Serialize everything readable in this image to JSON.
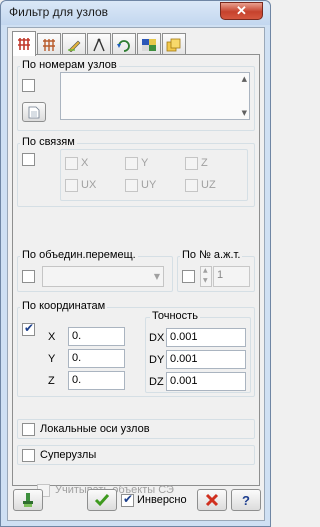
{
  "window": {
    "title": "Фильтр для узлов",
    "close_glyph": "✕"
  },
  "tabs": [
    {
      "icon": "node-filter-icon"
    },
    {
      "icon": "element-filter-icon"
    },
    {
      "icon": "pencil-filter-icon"
    },
    {
      "icon": "compass-filter-icon"
    },
    {
      "icon": "rotate-filter-icon"
    },
    {
      "icon": "color-grid-icon"
    },
    {
      "icon": "layers-copy-icon"
    }
  ],
  "by_numbers": {
    "label": "По номерам узлов"
  },
  "by_links": {
    "label": "По связям",
    "dofs": [
      "X",
      "Y",
      "Z",
      "UX",
      "UY",
      "UZ"
    ]
  },
  "by_union": {
    "label": "По объедин.перемещ."
  },
  "by_stiffness": {
    "label": "По № а.ж.т.",
    "value": "1"
  },
  "by_coords": {
    "label": "По координатам",
    "checked": true,
    "rows": [
      {
        "axis": "X",
        "value": "0."
      },
      {
        "axis": "Y",
        "value": "0."
      },
      {
        "axis": "Z",
        "value": "0."
      }
    ],
    "accuracy_label": "Точность",
    "accuracy": [
      {
        "axis": "DX",
        "value": "0.001"
      },
      {
        "axis": "DY",
        "value": "0.001"
      },
      {
        "axis": "DZ",
        "value": "0.001"
      }
    ]
  },
  "local_axes_label": "Локальные оси узлов",
  "supernodes_label": "Суперузлы",
  "fe_objects_label": "Учитывать объекты СЭ",
  "bottom": {
    "inverse_label": "Инверсно",
    "help_label": "?"
  }
}
